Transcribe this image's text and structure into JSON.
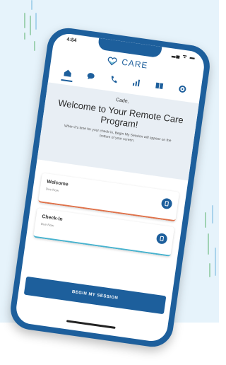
{
  "status_bar": {
    "time": "4:54",
    "icons": "▂▄ ᯤ ▬"
  },
  "logo": {
    "text": "CARE",
    "icon": "heart-icon"
  },
  "nav": {
    "items": [
      "home-icon",
      "chat-icon",
      "phone-icon",
      "stats-icon",
      "library-icon",
      "settings-icon"
    ],
    "active": "home-icon"
  },
  "hero": {
    "name": "Cade,",
    "title": "Welcome to Your Remote Care Program!",
    "subtitle": "When it's time for your check-in, Begin My Session will appear on the bottom of your screen."
  },
  "cards": [
    {
      "title": "Welcome",
      "due": "Due Now",
      "accent": "#e0724a",
      "icon": "clipboard-icon"
    },
    {
      "title": "Check-In",
      "due": "Due Now",
      "accent": "#47b3cf",
      "icon": "clipboard-icon"
    }
  ],
  "begin_button": {
    "label": "BEGIN MY SESSION"
  },
  "colors": {
    "brand": "#1d5f9c",
    "background": "#e6f3fb"
  }
}
